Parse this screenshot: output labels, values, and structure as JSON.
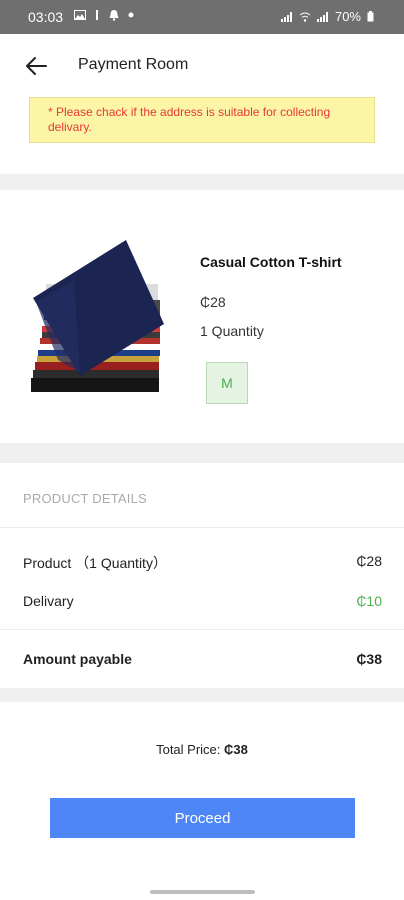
{
  "status_bar": {
    "time": "03:03",
    "battery": "70%",
    "icons": [
      "image-icon",
      "vibrate-icon",
      "notification-icon",
      "dot-icon",
      "signal-icon",
      "wifi-icon",
      "signal-icon",
      "battery-icon"
    ]
  },
  "app_bar": {
    "title": "Payment Room",
    "back_icon": "arrow-left-icon"
  },
  "notice": {
    "text": "* Please chack if the address is suitable for collecting delivary."
  },
  "product": {
    "name": "Casual Cotton T-shirt",
    "price": "₵28",
    "quantity": "1 Quantity",
    "size": "M",
    "image_icon": "stacked-tshirts-image"
  },
  "details": {
    "heading": "PRODUCT DETAILS",
    "rows": [
      {
        "label": "Product （1 Quantity）",
        "value": "₵28"
      },
      {
        "label": "Delivary",
        "value": "₵10"
      },
      {
        "label": "Amount payable",
        "value": "₵38"
      }
    ]
  },
  "total": {
    "label": "Total Price:",
    "value": "₵38"
  },
  "proceed_label": "Proceed",
  "colors": {
    "accent": "#4f86f7",
    "success": "#4caf50",
    "warning_bg": "#fdf5a6",
    "warning_text": "#e53935"
  }
}
